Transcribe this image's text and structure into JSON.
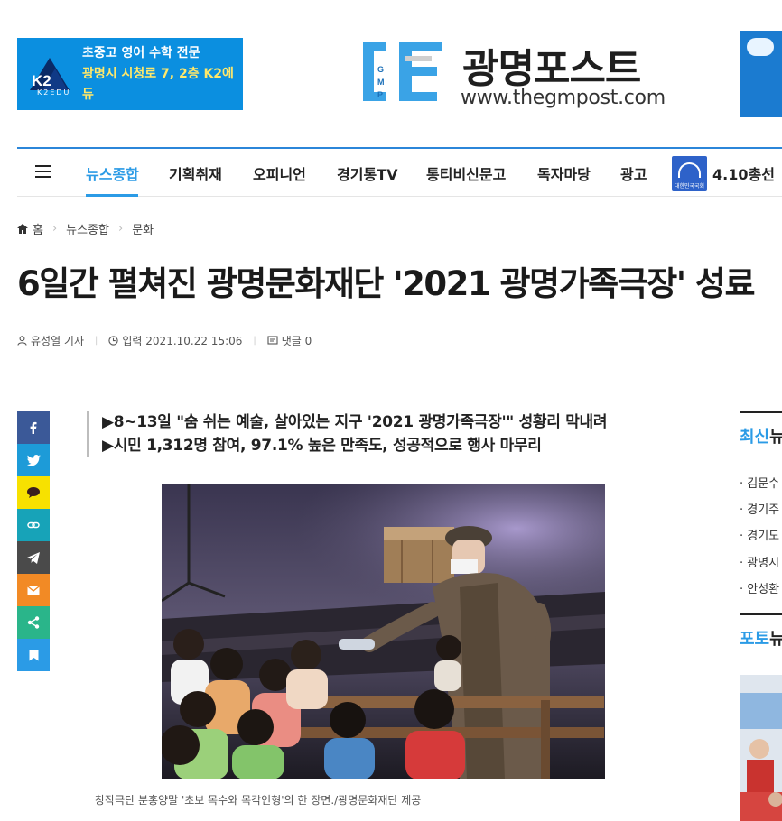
{
  "ad_left": {
    "logo_text": "K2EDU",
    "line1": "초중고 영어 수학 전문",
    "line2": "광명시 시청로 7, 2층 K2에듀"
  },
  "site": {
    "name": "광명포스트",
    "url": "www.thegmpost.com",
    "logo_small": [
      "Gwang",
      "Myeong",
      "Post"
    ]
  },
  "nav": {
    "items": [
      "뉴스종합",
      "기획취재",
      "오피니언",
      "경기통TV",
      "통티비신문고",
      "독자마당",
      "광고"
    ],
    "badge_caption": "대한민국국회",
    "election": "4.10총선"
  },
  "breadcrumb": [
    "홈",
    "뉴스종합",
    "문화"
  ],
  "article": {
    "title": "6일간 펼쳐진 광명문화재단 '2021 광명가족극장' 성료",
    "reporter": "유성열 기자",
    "date": "입력 2021.10.22 15:06",
    "comments": "댓글 0",
    "subtitles": [
      "▶8~13일 \"숨 쉬는 예술, 살아있는 지구 '2021 광명가족극장'\" 성황리 막내려",
      "▶시민 1,312명 참여, 97.1% 높은 만족도, 성공적으로 행사 마무리"
    ],
    "caption": "창작극단 분홍양말 '초보 목수와 목각인형'의 한 장면./광명문화재단 제공"
  },
  "share": [
    {
      "icon": "facebook-icon",
      "color": "#3b5998"
    },
    {
      "icon": "twitter-icon",
      "color": "#1d9bd8"
    },
    {
      "icon": "kakaotalk-icon",
      "color": "#f7e100"
    },
    {
      "icon": "link-icon",
      "color": "#17a3b8"
    },
    {
      "icon": "telegram-icon",
      "color": "#4a4a4a"
    },
    {
      "icon": "email-icon",
      "color": "#f28a25"
    },
    {
      "icon": "share-icon",
      "color": "#2ab58a"
    },
    {
      "icon": "bookmark-icon",
      "color": "#2b9be6"
    }
  ],
  "sidebar": {
    "latest_title_a": "최신",
    "latest_title_b": "뉴스",
    "latest": [
      "김문수",
      "경기주",
      "경기도",
      "광명시",
      "안성환"
    ],
    "photo_title_a": "포토",
    "photo_title_b": "뉴스"
  },
  "colors": {
    "accent": "#2b9be6",
    "nav_border": "#2b86d9"
  }
}
